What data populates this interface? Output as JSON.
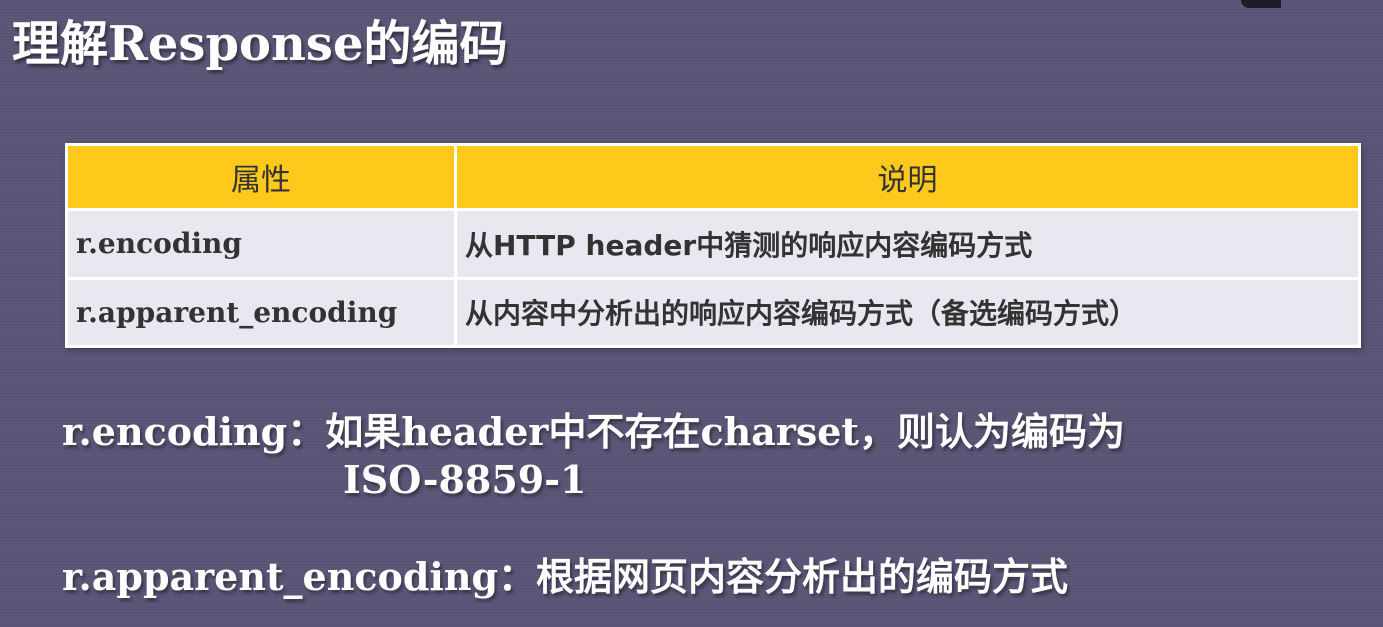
{
  "title": "理解Response的编码",
  "table": {
    "headers": [
      "属性",
      "说明"
    ],
    "rows": [
      {
        "attr": "r.encoding",
        "desc": "从HTTP header中猜测的响应内容编码方式"
      },
      {
        "attr": "r.apparent_encoding",
        "desc": "从内容中分析出的响应内容编码方式（备选编码方式）"
      }
    ]
  },
  "notes": [
    {
      "line1": "r.encoding：如果header中不存在charset，则认为编码为",
      "line2": "ISO-8859-1"
    },
    {
      "line1": "r.apparent_encoding：根据网页内容分析出的编码方式"
    }
  ],
  "colors": {
    "background": "#5a5576",
    "header_fill": "#ffc91b",
    "row_fill": "#e9e7f0",
    "text_light": "#ffffff",
    "text_dark": "#333333"
  }
}
